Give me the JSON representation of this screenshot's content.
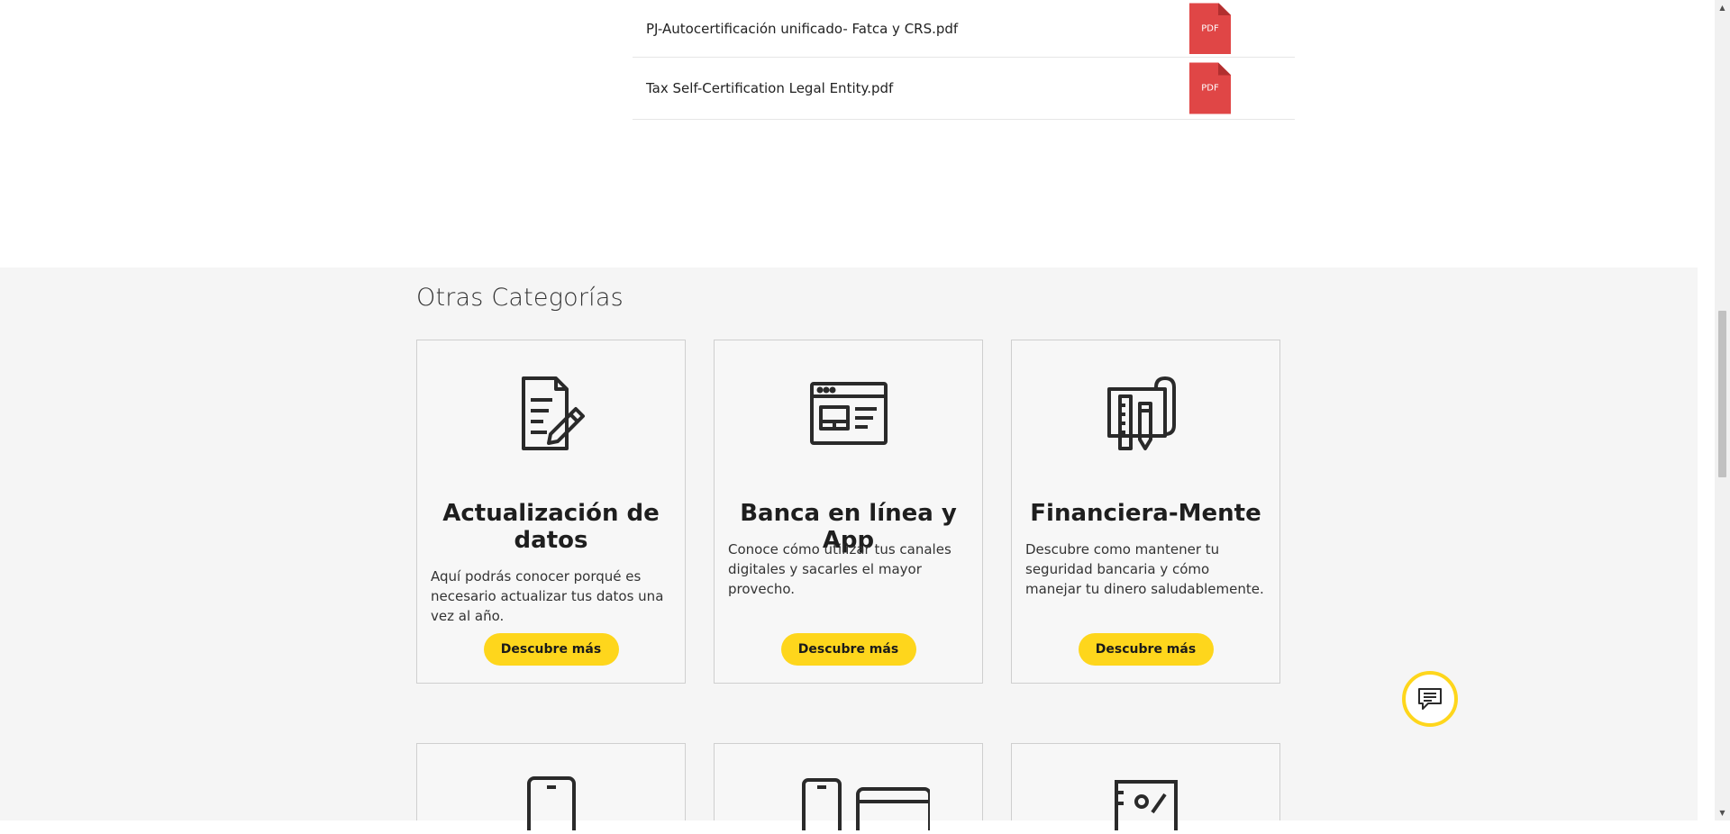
{
  "documents": [
    {
      "name": "PJ-Autocertificación unificado- Fatca y CRS.pdf",
      "badge": "PDF"
    },
    {
      "name": "Tax Self-Certification Legal Entity.pdf",
      "badge": "PDF"
    }
  ],
  "others": {
    "title": "Otras Categorías",
    "cards": [
      {
        "icon": "document-edit-icon",
        "title": "Actualización de datos",
        "description": "Aquí podrás conocer porqué es necesario actualizar tus datos una vez al año.",
        "button": "Descubre más"
      },
      {
        "icon": "browser-window-icon",
        "title": "Banca en línea y App",
        "description": "Conoce cómo utilizar tus canales digitales y sacarles el mayor provecho.",
        "button": "Descubre más"
      },
      {
        "icon": "finance-tools-icon",
        "title": "Financiera-Mente",
        "description": "Descubre como mantener tu seguridad bancaria y cómo manejar tu dinero saludablemente.",
        "button": "Descubre más"
      }
    ],
    "bottom_cards": [
      {
        "icon": "tablet-icon"
      },
      {
        "icon": "phone-card-icon"
      },
      {
        "icon": "id-card-icon"
      }
    ]
  },
  "chat": {
    "icon": "chat-icon"
  },
  "colors": {
    "accent": "#fed61c",
    "pdf": "#e04646",
    "section_bg": "#f5f5f5"
  }
}
